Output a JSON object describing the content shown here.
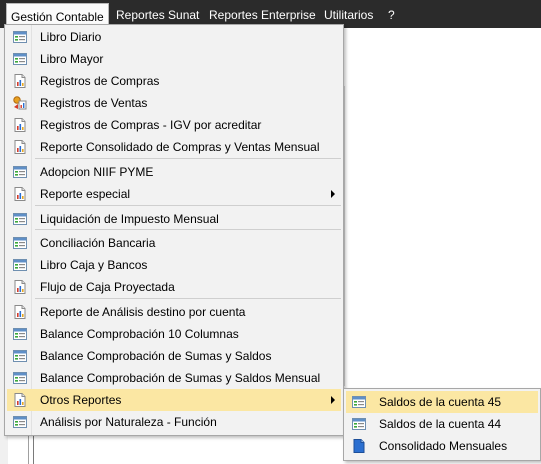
{
  "menubar": {
    "items": [
      "Gestión Contable",
      "Reportes Sunat",
      "Reportes Enterprise",
      "Utilitarios",
      "?"
    ]
  },
  "menu": {
    "items": [
      {
        "label": "Libro Diario",
        "icon": "spreadsheet-icon"
      },
      {
        "label": "Libro Mayor",
        "icon": "spreadsheet-icon"
      },
      {
        "label": "Registros de Compras",
        "icon": "report-chart-icon"
      },
      {
        "label": "Registros de Ventas",
        "icon": "sales-register-icon"
      },
      {
        "label": "Registros de Compras - IGV por acreditar",
        "icon": "report-chart-icon"
      },
      {
        "label": "Reporte Consolidado de Compras y Ventas Mensual",
        "icon": "report-chart-icon"
      },
      {
        "label": "Adopcion NIIF PYME",
        "icon": "spreadsheet-icon"
      },
      {
        "label": "Reporte especial",
        "icon": "report-chart-icon",
        "submenu": true
      },
      {
        "label": "Liquidación de Impuesto Mensual",
        "icon": "spreadsheet-icon"
      },
      {
        "label": "Conciliación Bancaria",
        "icon": "spreadsheet-icon"
      },
      {
        "label": "Libro Caja y Bancos",
        "icon": "spreadsheet-icon"
      },
      {
        "label": "Flujo de Caja Proyectada",
        "icon": "report-chart-icon"
      },
      {
        "label": "Reporte de Análisis destino por cuenta",
        "icon": "report-chart-icon"
      },
      {
        "label": "Balance Comprobación 10 Columnas",
        "icon": "spreadsheet-icon"
      },
      {
        "label": "Balance Comprobación de Sumas y Saldos",
        "icon": "spreadsheet-icon"
      },
      {
        "label": "Balance Comprobación de Sumas y Saldos Mensual",
        "icon": "spreadsheet-icon"
      },
      {
        "label": "Otros Reportes",
        "icon": "report-chart-icon",
        "submenu": true,
        "highlighted": true
      },
      {
        "label": "Análisis por Naturaleza - Función",
        "icon": "spreadsheet-icon"
      }
    ]
  },
  "submenu": {
    "items": [
      {
        "label": "Saldos de la cuenta 45",
        "icon": "spreadsheet-icon",
        "highlighted": true
      },
      {
        "label": "Saldos de la cuenta 44",
        "icon": "spreadsheet-icon"
      },
      {
        "label": "Consolidado Mensuales",
        "icon": "blue-document-icon"
      }
    ]
  },
  "colors": {
    "menubar_bg": "#2b2b2b",
    "menu_bg": "#f2f2f2",
    "highlight": "#fbe7a3"
  }
}
